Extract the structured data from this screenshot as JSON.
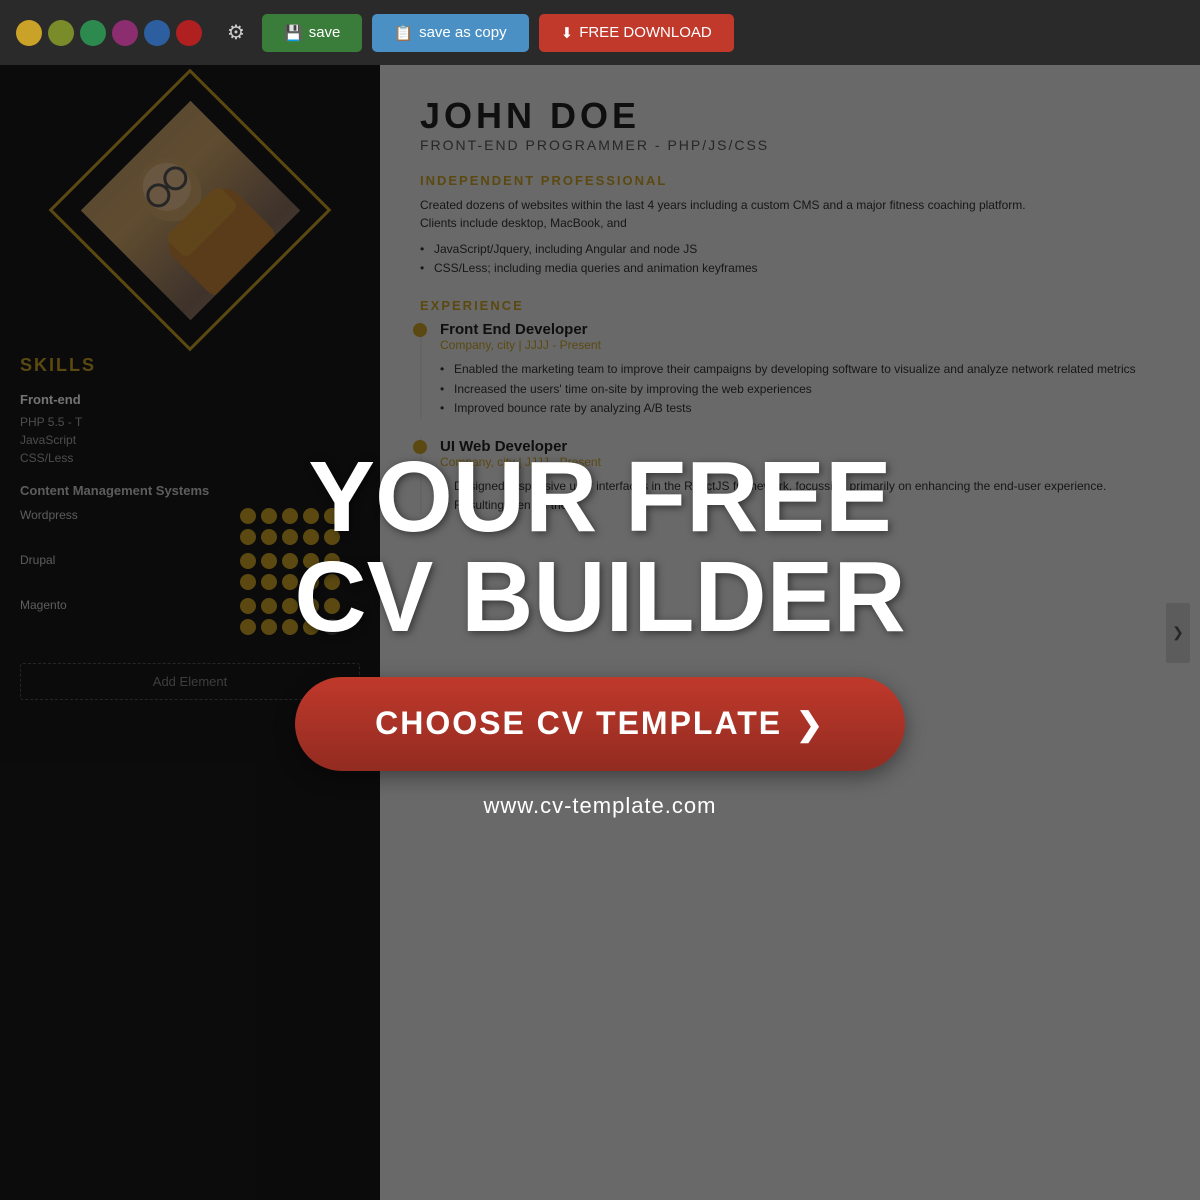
{
  "toolbar": {
    "colors": [
      {
        "name": "yellow",
        "hex": "#c9a227"
      },
      {
        "name": "olive",
        "hex": "#7a8c2a"
      },
      {
        "name": "green",
        "hex": "#2d8a4e"
      },
      {
        "name": "purple",
        "hex": "#8b2d6e"
      },
      {
        "name": "blue",
        "hex": "#2d5fa0"
      },
      {
        "name": "red",
        "hex": "#b02020"
      }
    ],
    "save_label": "save",
    "save_copy_label": "save as copy",
    "download_label": "FREE DOWNLOAD"
  },
  "cv": {
    "name": "JOHN  DOE",
    "title": "FRONT-END PROGRAMMER - PHP/JS/CSS",
    "sections": {
      "summary_header": "INDEPENDENT PROFESSIONAL",
      "summary_text": "Created dozens of websites within the last 4 years including a custom CMS and a major fitness coaching platform.",
      "summary_text2": "Clients include desktop, MacBook, and",
      "bullets": [
        "JavaScript/Jquery, including Angular and node JS",
        "CSS/Less; including media queries and animation keyframes"
      ],
      "skills": {
        "title": "SKILLS",
        "front_end_title": "Front-end",
        "front_end_text": "PHP 5.5 - T\nJavaScript\nCSS/Less",
        "cms_title": "Content Management Systems",
        "cms_items": [
          {
            "name": "Wordpress",
            "filled": 5,
            "empty": 0
          },
          {
            "name": "Drupal",
            "filled": 5,
            "empty": 0
          },
          {
            "name": "Magento",
            "filled": 4,
            "empty": 1
          }
        ],
        "add_element": "Add Element"
      },
      "experience": {
        "title": "EXPERIENCE",
        "jobs": [
          {
            "title": "Front End Developer",
            "company": "Company, city | JJJJ - Present",
            "bullets": [
              "Enabled the marketing team to improve their campaigns by developing software to visualize and analyze network related metrics",
              "Increased the users' time on-site by improving the web experiences",
              "Improved bounce rate by analyzing A/B tests"
            ]
          },
          {
            "title": "UI Web Developer",
            "company": "Company, city | JJJJ - Present",
            "bullets": [
              "Designed responsive user interfaces in the ReactJS framework, focussing primarily on enhancing the end-user experience.",
              "Resulting then on the"
            ]
          }
        ]
      }
    }
  },
  "overlay": {
    "headline_line1": "YOUR FREE",
    "headline_line2": "CV BUILDER",
    "cta_label": "CHOOSE CV TEMPLATE",
    "cta_arrow": "❯",
    "url": "www.cv-template.com"
  }
}
